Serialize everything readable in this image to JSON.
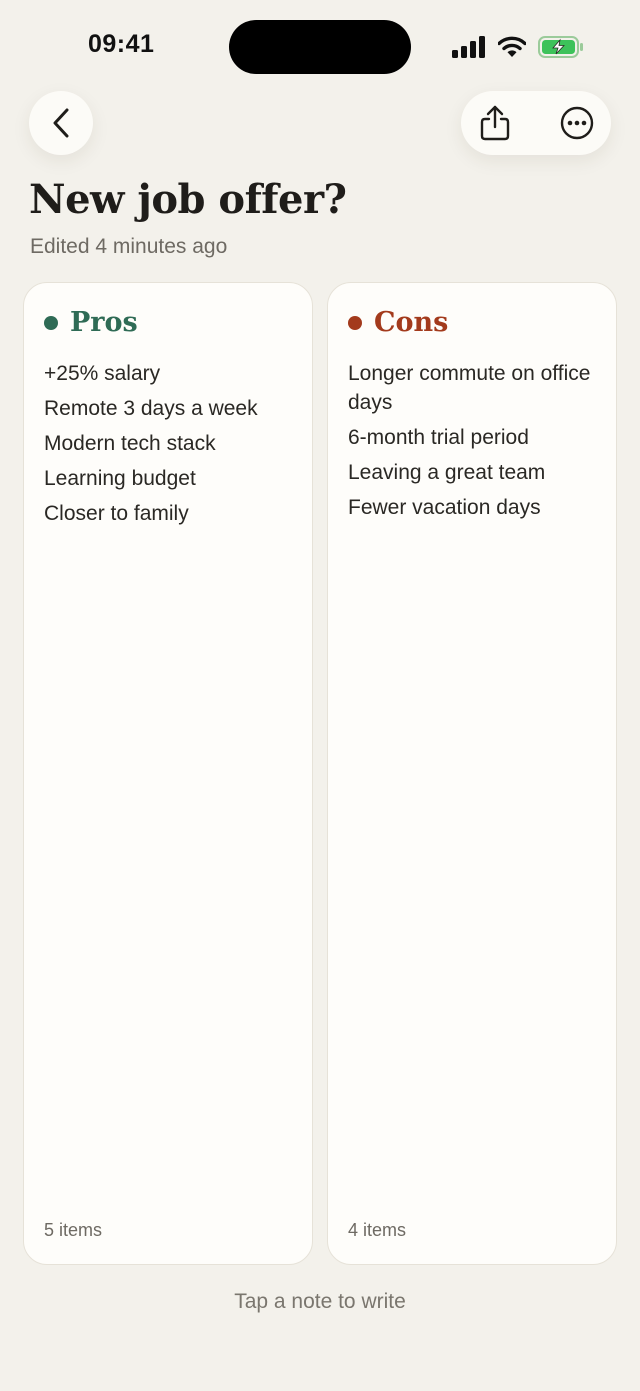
{
  "status_bar": {
    "time": "09:41"
  },
  "header": {
    "title": "New job offer?",
    "edited": "Edited 4 minutes ago"
  },
  "icons": {
    "back": "chevron-left-icon",
    "share": "share-icon",
    "more": "ellipsis-circle-icon"
  },
  "colors": {
    "pros": "#2F6B55",
    "cons": "#A33A1C",
    "background": "#F3F1EB",
    "card": "#FEFDFA"
  },
  "pros": {
    "title": "Pros",
    "items": [
      "+25% salary",
      "Remote 3 days a week",
      "Modern tech stack",
      "Learning budget",
      "Closer to family"
    ],
    "count": "5 items"
  },
  "cons": {
    "title": "Cons",
    "items": [
      "Longer commute on office days",
      "6-month trial period",
      "Leaving a great team",
      "Fewer vacation days"
    ],
    "count": "4 items"
  },
  "hint": "Tap a note to write"
}
